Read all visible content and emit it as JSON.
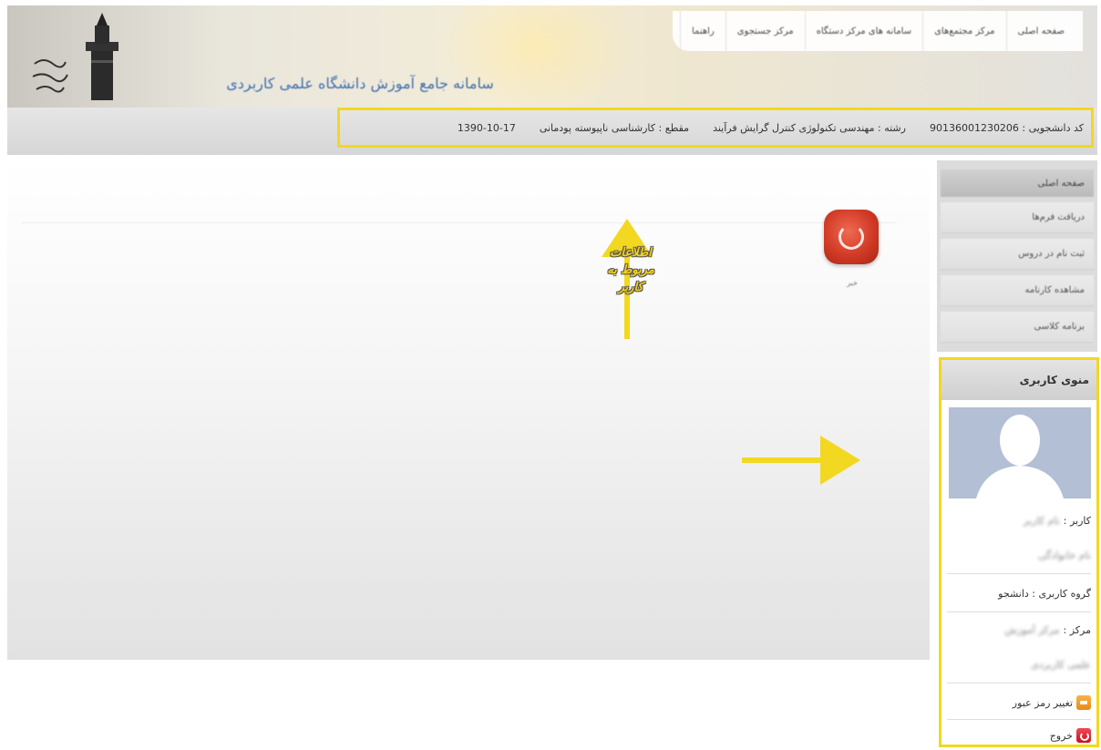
{
  "header": {
    "site_title": "سامانه جامع آموزش دانشگاه علمی کاربردی",
    "nav_items": [
      "صفحه اصلی",
      "مرکز مجتمع‌های",
      "سامانه های مرکز دستگاه",
      "مرکز جستجوی",
      "راهنما"
    ]
  },
  "info_bar": {
    "student_code": "کد دانشجویی : 90136001230206",
    "major": "رشته : مهندسی تکنولوژی کنترل گرایش فرآیند",
    "degree": "مقطع : کارشناسی ناپیوسته پودمانی",
    "date": "1390-10-17"
  },
  "content": {
    "news_label": "خبر",
    "annotation": [
      "اطلاعات",
      "مربوط به",
      "کاربر"
    ]
  },
  "sidebar": {
    "head": "صفحه اصلی",
    "items": [
      "دریافت فرم‌ها",
      "ثبت نام در دروس",
      "مشاهده کارنامه",
      "برنامه کلاسی"
    ]
  },
  "user_menu": {
    "title": "منوی کاربری",
    "user_label": "کاربر :",
    "user_value": "نام کاربر",
    "user_value2": "نام خانوادگی",
    "group_label": "گروه کاربری : دانشجو",
    "center_label": "مرکز :",
    "center_value": "مرکز آموزش",
    "center_value2": "علمی کاربردی",
    "change_password": "تغییر رمز عبور",
    "logout": "خروج"
  },
  "colors": {
    "highlight": "#f2d820",
    "title_blue": "#3e6fb0",
    "news_icon": "#d13a26"
  }
}
